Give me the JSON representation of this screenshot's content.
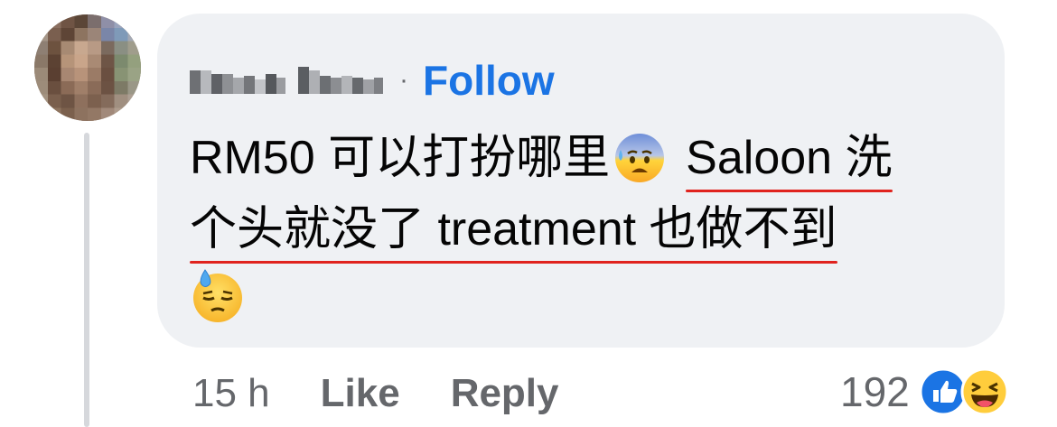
{
  "comment": {
    "follow_label": "Follow",
    "separator": "·",
    "text": {
      "line1_part1": "RM50 可以打扮哪里",
      "line1_underlined": "Saloon 洗",
      "line2_underlined": "个头就没了 treatment 也做不到"
    },
    "emojis": [
      "anxious-face-with-sweat",
      "downcast-face-with-sweat"
    ]
  },
  "footer": {
    "time": "15 h",
    "like_label": "Like",
    "reply_label": "Reply",
    "reaction_count": "192",
    "reaction_icons": [
      "like-icon",
      "haha-icon"
    ]
  },
  "colors": {
    "bubble": "#eff1f4",
    "follow": "#1b74e4",
    "secondary_text": "#65676b",
    "underline": "#e0231e"
  }
}
